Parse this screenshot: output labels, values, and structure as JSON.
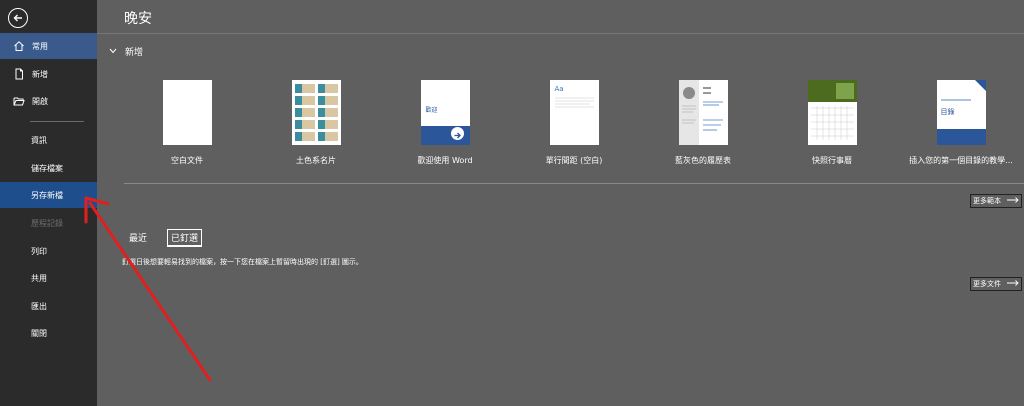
{
  "sidebar": {
    "items": [
      {
        "label": "常用"
      },
      {
        "label": "新增"
      },
      {
        "label": "開啟"
      },
      {
        "label": "資訊"
      },
      {
        "label": "儲存檔案"
      },
      {
        "label": "另存新檔"
      },
      {
        "label": "歷程記錄"
      },
      {
        "label": "列印"
      },
      {
        "label": "共用"
      },
      {
        "label": "匯出"
      },
      {
        "label": "關閉"
      }
    ]
  },
  "main": {
    "greeting": "晚安",
    "new_section_label": "新增",
    "templates": [
      {
        "label": "空白文件"
      },
      {
        "label": "土色系名片"
      },
      {
        "label": "歡迎使用 Word",
        "thumb_text": "歡迎"
      },
      {
        "label": "單行間距 (空白)",
        "thumb_text": "Aa"
      },
      {
        "label": "藍灰色的履歷表"
      },
      {
        "label": "快照行事曆"
      },
      {
        "label": "插入您的第一個目錄的教學...",
        "thumb_text": "目錄"
      }
    ],
    "more_templates": "更多範本",
    "tabs": [
      {
        "label": "最近"
      },
      {
        "label": "已釘選"
      }
    ],
    "pinned_description": "釘選日後想要輕易找到的檔案，按一下您在檔案上暫留時出現的 [釘選] 圖示。",
    "more_documents": "更多文件"
  },
  "colors": {
    "sidebar_bg": "#2b2b2b",
    "main_bg": "#5f5f5f",
    "selected": "#1f4e8c",
    "accent_blue": "#2b579a",
    "annotation_red": "#e02020"
  }
}
